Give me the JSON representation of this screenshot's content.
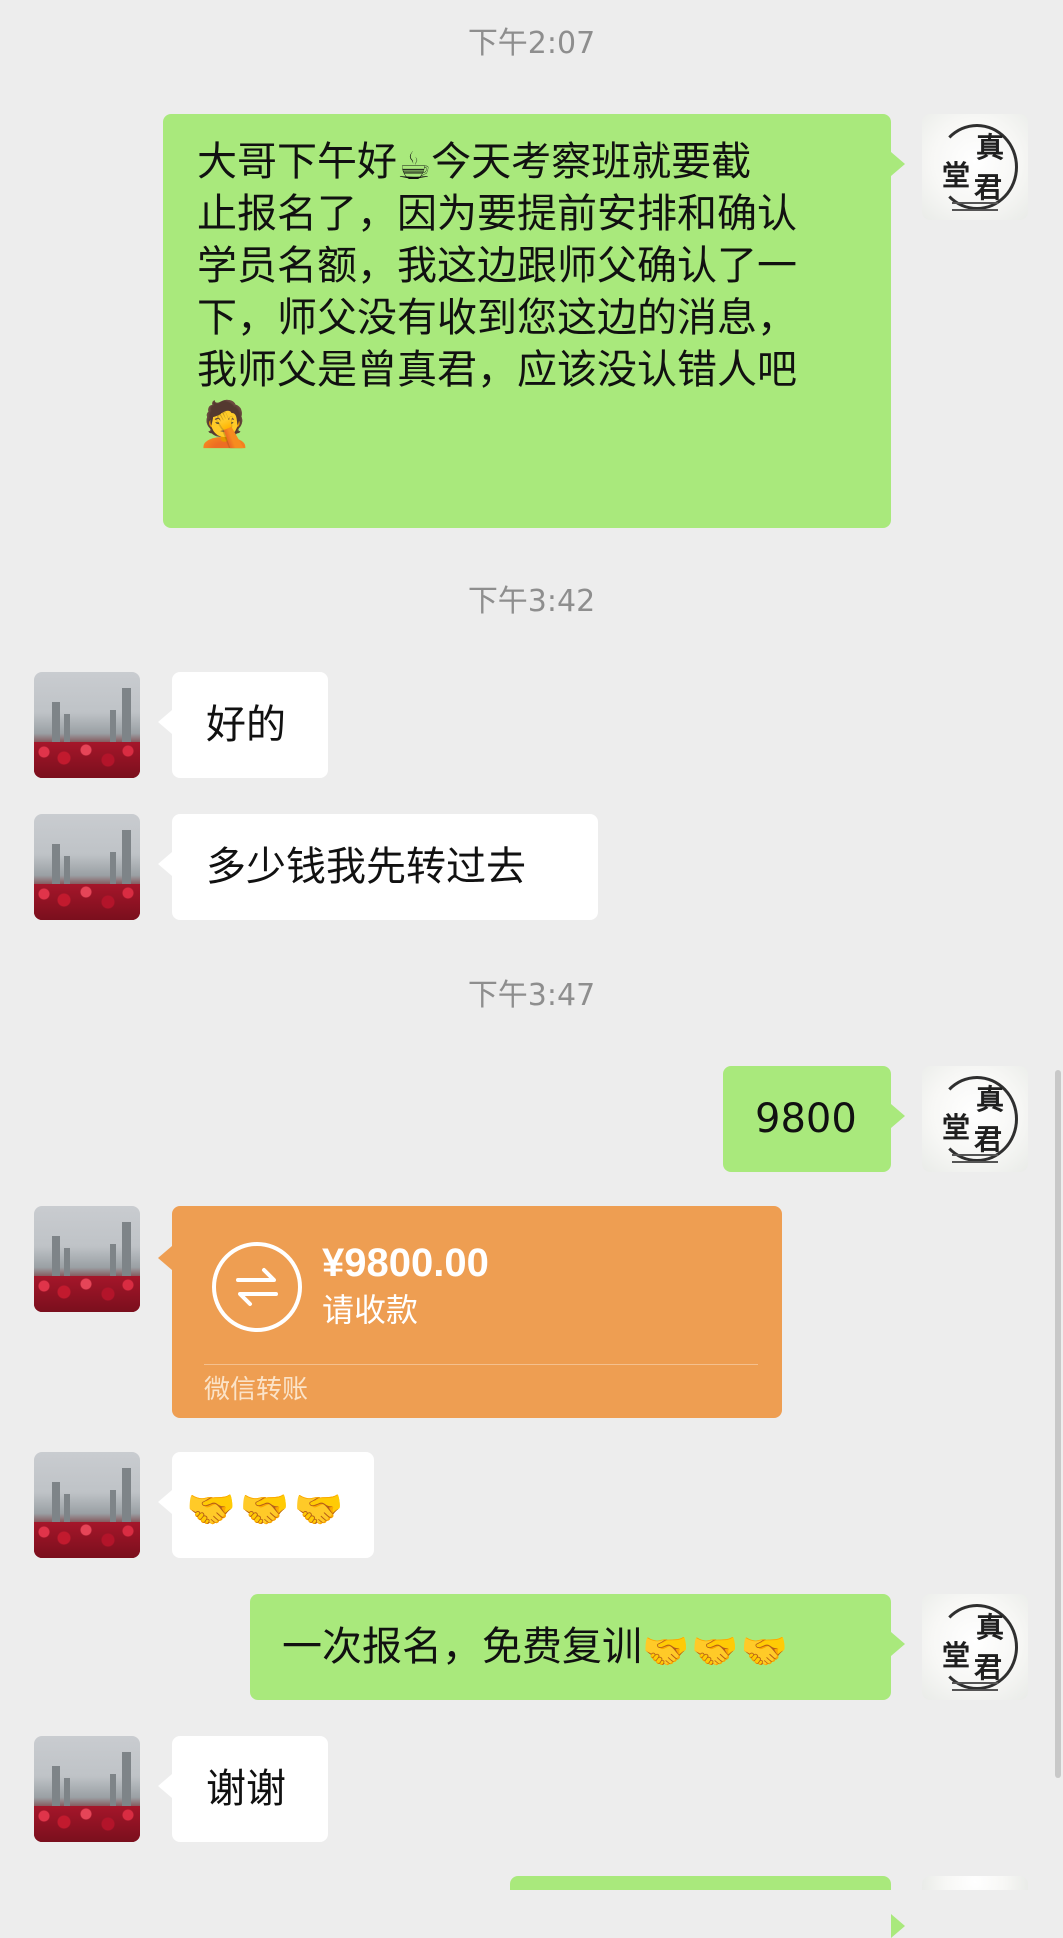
{
  "timestamps": [
    "下午2:07",
    "下午3:42",
    "下午3:47"
  ],
  "messages": {
    "m1": {
      "lines": [
        "大哥下午好",
        "今天考察班就要截",
        "止报名了，因为要提前安排和确认",
        "学员名额，我这边跟师父确认了一",
        "下，师父没有收到您这边的消息，",
        "我师父是曾真君，应该没认错人吧"
      ],
      "emoji_coffee": "☕",
      "emoji_facepalm": "🤦"
    },
    "m2": "好的",
    "m3": "多少钱我先转过去",
    "m4": "9800",
    "m6": "🤝🤝🤝",
    "m7": "一次报名，免费复训",
    "m7_emoji": "🤝🤝🤝",
    "m8": "谢谢"
  },
  "transfer": {
    "amount": "¥9800.00",
    "status": "请收款",
    "footer": "微信转账",
    "color": "#ee9e52",
    "icon": "transfer-arrows-icon"
  },
  "avatars": {
    "self": "seal-logo-avatar",
    "self_chars": [
      "真",
      "堂",
      "君"
    ],
    "other": "city-skyline-avatar"
  },
  "colors": {
    "background": "#ededed",
    "my_bubble": "#a9e97c",
    "other_bubble": "#ffffff"
  }
}
